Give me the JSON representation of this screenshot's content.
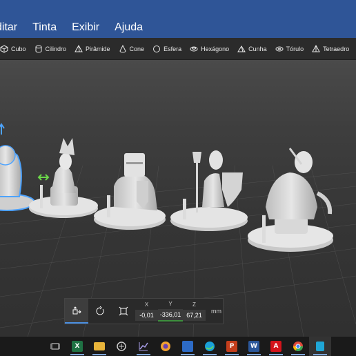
{
  "menu": {
    "items": [
      "ditar",
      "Tinta",
      "Exibir",
      "Ajuda"
    ]
  },
  "shapes": {
    "items": [
      {
        "label": "Cubo",
        "icon": "cube-icon"
      },
      {
        "label": "Cilindro",
        "icon": "cylinder-icon"
      },
      {
        "label": "Pirâmide",
        "icon": "pyramid-icon"
      },
      {
        "label": "Cone",
        "icon": "cone-icon"
      },
      {
        "label": "Esfera",
        "icon": "sphere-icon"
      },
      {
        "label": "Hexágono",
        "icon": "hexagon-icon"
      },
      {
        "label": "Cunha",
        "icon": "wedge-icon"
      },
      {
        "label": "Tórulo",
        "icon": "torus-icon"
      },
      {
        "label": "Tetraedro",
        "icon": "tetrahedron-icon"
      }
    ]
  },
  "transform": {
    "x_label": "X",
    "x_value": "-0,01",
    "y_label": "Y",
    "y_value": "-336,01",
    "z_label": "Z",
    "z_value": "67,21",
    "unit": "mm"
  },
  "taskbar": {
    "apps": [
      {
        "name": "task-view-icon",
        "letter": "",
        "color": "#1a1a1a"
      },
      {
        "name": "excel-icon",
        "letter": "X",
        "color": "#1f7244"
      },
      {
        "name": "file-explorer-icon",
        "letter": "",
        "color": "#e8b43a"
      },
      {
        "name": "app-circle-icon",
        "letter": "",
        "color": "#555555"
      },
      {
        "name": "chart-app-icon",
        "letter": "",
        "color": "#6a5acd"
      },
      {
        "name": "browser-circle-icon",
        "letter": "",
        "color": "#f0a030"
      },
      {
        "name": "document-app-icon",
        "letter": "",
        "color": "#2d6bc6"
      },
      {
        "name": "edge-icon",
        "letter": "",
        "color": "#1aa0d8"
      },
      {
        "name": "powerpoint-icon",
        "letter": "P",
        "color": "#c43e1c"
      },
      {
        "name": "word-icon",
        "letter": "W",
        "color": "#2b579a"
      },
      {
        "name": "acrobat-icon",
        "letter": "A",
        "color": "#d4131b"
      },
      {
        "name": "chrome-icon",
        "letter": "",
        "color": "#e04a3a"
      },
      {
        "name": "paint3d-icon",
        "letter": "",
        "color": "#1fa6d6"
      }
    ]
  }
}
